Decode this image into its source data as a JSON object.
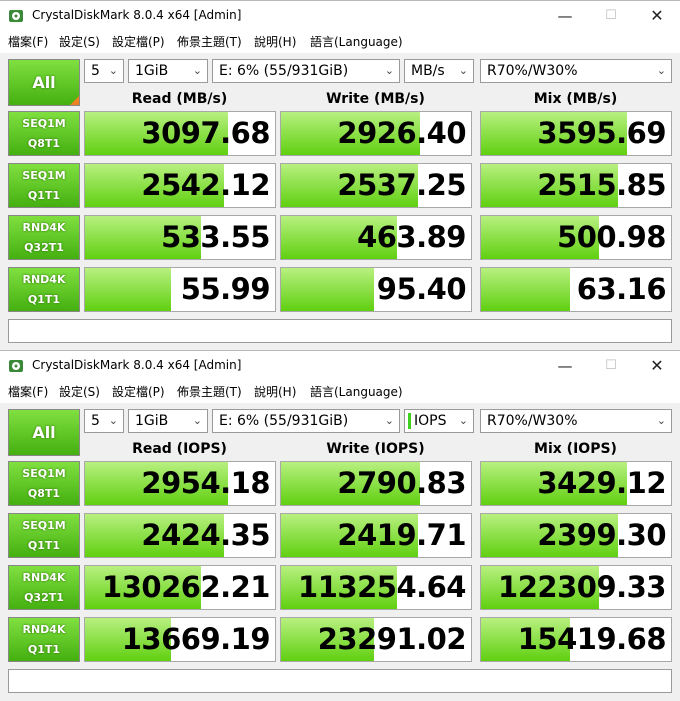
{
  "windows": [
    {
      "title": "CrystalDiskMark 8.0.4 x64 [Admin]",
      "menu": [
        "檔案(F)",
        "設定(S)",
        "設定檔(P)",
        "佈景主題(T)",
        "說明(H)",
        "語言(Language)"
      ],
      "all_label": "All",
      "count": "5",
      "size": "1GiB",
      "drive": "E: 6% (55/931GiB)",
      "unit": "MB/s",
      "mix": "R70%/W30%",
      "headers": [
        "Read (MB/s)",
        "Write (MB/s)",
        "Mix (MB/s)"
      ],
      "tests": [
        {
          "line1": "SEQ1M",
          "line2": "Q8T1",
          "values": [
            "3097.68",
            "2926.40",
            "3595.69"
          ],
          "bars": [
            0.75,
            0.73,
            0.77
          ]
        },
        {
          "line1": "SEQ1M",
          "line2": "Q1T1",
          "values": [
            "2542.12",
            "2537.25",
            "2515.85"
          ],
          "bars": [
            0.73,
            0.72,
            0.72
          ]
        },
        {
          "line1": "RND4K",
          "line2": "Q32T1",
          "values": [
            "533.55",
            "463.89",
            "500.98"
          ],
          "bars": [
            0.61,
            0.61,
            0.62
          ]
        },
        {
          "line1": "RND4K",
          "line2": "Q1T1",
          "values": [
            "55.99",
            "95.40",
            "63.16"
          ],
          "bars": [
            0.45,
            0.49,
            0.47
          ]
        }
      ],
      "comment": ""
    },
    {
      "title": "CrystalDiskMark 8.0.4 x64 [Admin]",
      "menu": [
        "檔案(F)",
        "設定(S)",
        "設定檔(P)",
        "佈景主題(T)",
        "說明(H)",
        "語言(Language)"
      ],
      "all_label": "All",
      "count": "5",
      "size": "1GiB",
      "drive": "E: 6% (55/931GiB)",
      "unit": "IOPS",
      "mix": "R70%/W30%",
      "headers": [
        "Read (IOPS)",
        "Write (IOPS)",
        "Mix (IOPS)"
      ],
      "tests": [
        {
          "line1": "SEQ1M",
          "line2": "Q8T1",
          "values": [
            "2954.18",
            "2790.83",
            "3429.12"
          ],
          "bars": [
            0.75,
            0.73,
            0.77
          ]
        },
        {
          "line1": "SEQ1M",
          "line2": "Q1T1",
          "values": [
            "2424.35",
            "2419.71",
            "2399.30"
          ],
          "bars": [
            0.73,
            0.72,
            0.72
          ]
        },
        {
          "line1": "RND4K",
          "line2": "Q32T1",
          "values": [
            "130262.21",
            "113254.64",
            "122309.33"
          ],
          "bars": [
            0.61,
            0.61,
            0.62
          ]
        },
        {
          "line1": "RND4K",
          "line2": "Q1T1",
          "values": [
            "13669.19",
            "23291.02",
            "15419.68"
          ],
          "bars": [
            0.45,
            0.49,
            0.47
          ]
        }
      ],
      "comment": ""
    }
  ]
}
